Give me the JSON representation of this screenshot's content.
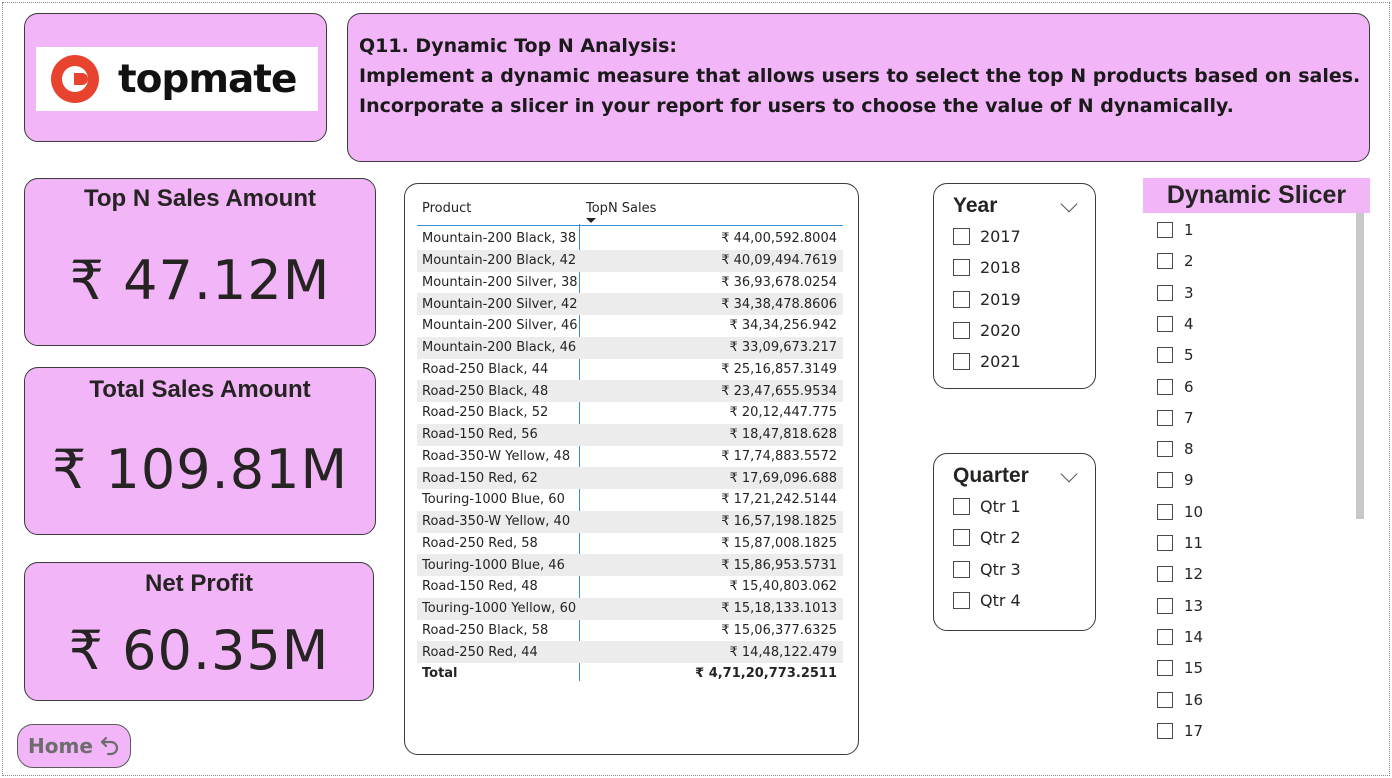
{
  "logo": {
    "text": "topmate",
    "brand_color": "#e8432e"
  },
  "question": {
    "line1": "Q11. Dynamic Top N Analysis:",
    "line2": "Implement a dynamic measure that allows users to select the top N products based on sales.",
    "line3": "Incorporate a slicer in your report for users to choose the value of N dynamically."
  },
  "kpis": [
    {
      "title": "Top N Sales Amount",
      "value": "₹ 47.12M"
    },
    {
      "title": "Total Sales Amount",
      "value": "₹ 109.81M"
    },
    {
      "title": "Net Profit",
      "value": "₹ 60.35M"
    }
  ],
  "home_button": {
    "label": "Home",
    "icon": "undo-arrow-icon"
  },
  "table": {
    "headers": {
      "product": "Product",
      "sales": "TopN Sales"
    },
    "rows": [
      {
        "product": "Mountain-200 Black, 38",
        "sales": "₹ 44,00,592.8004"
      },
      {
        "product": "Mountain-200 Black, 42",
        "sales": "₹ 40,09,494.7619"
      },
      {
        "product": "Mountain-200 Silver, 38",
        "sales": "₹ 36,93,678.0254"
      },
      {
        "product": "Mountain-200 Silver, 42",
        "sales": "₹ 34,38,478.8606"
      },
      {
        "product": "Mountain-200 Silver, 46",
        "sales": "₹ 34,34,256.942"
      },
      {
        "product": "Mountain-200 Black, 46",
        "sales": "₹ 33,09,673.217"
      },
      {
        "product": "Road-250 Black, 44",
        "sales": "₹ 25,16,857.3149"
      },
      {
        "product": "Road-250 Black, 48",
        "sales": "₹ 23,47,655.9534"
      },
      {
        "product": "Road-250 Black, 52",
        "sales": "₹ 20,12,447.775"
      },
      {
        "product": "Road-150 Red, 56",
        "sales": "₹ 18,47,818.628"
      },
      {
        "product": "Road-350-W Yellow, 48",
        "sales": "₹ 17,74,883.5572"
      },
      {
        "product": "Road-150 Red, 62",
        "sales": "₹ 17,69,096.688"
      },
      {
        "product": "Touring-1000 Blue, 60",
        "sales": "₹ 17,21,242.5144"
      },
      {
        "product": "Road-350-W Yellow, 40",
        "sales": "₹ 16,57,198.1825"
      },
      {
        "product": "Road-250 Red, 58",
        "sales": "₹ 15,87,008.1825"
      },
      {
        "product": "Touring-1000 Blue, 46",
        "sales": "₹ 15,86,953.5731"
      },
      {
        "product": "Road-150 Red, 48",
        "sales": "₹ 15,40,803.062"
      },
      {
        "product": "Touring-1000 Yellow, 60",
        "sales": "₹ 15,18,133.1013"
      },
      {
        "product": "Road-250 Black, 58",
        "sales": "₹ 15,06,377.6325"
      },
      {
        "product": "Road-250 Red, 44",
        "sales": "₹ 14,48,122.479"
      }
    ],
    "total": {
      "label": "Total",
      "value": "₹ 4,71,20,773.2511"
    }
  },
  "year_slicer": {
    "title": "Year",
    "options": [
      "2017",
      "2018",
      "2019",
      "2020",
      "2021"
    ]
  },
  "quarter_slicer": {
    "title": "Quarter",
    "options": [
      "Qtr 1",
      "Qtr 2",
      "Qtr 3",
      "Qtr 4"
    ]
  },
  "dynamic_slicer": {
    "title": "Dynamic Slicer",
    "options": [
      "1",
      "2",
      "3",
      "4",
      "5",
      "6",
      "7",
      "8",
      "9",
      "10",
      "11",
      "12",
      "13",
      "14",
      "15",
      "16",
      "17"
    ]
  }
}
